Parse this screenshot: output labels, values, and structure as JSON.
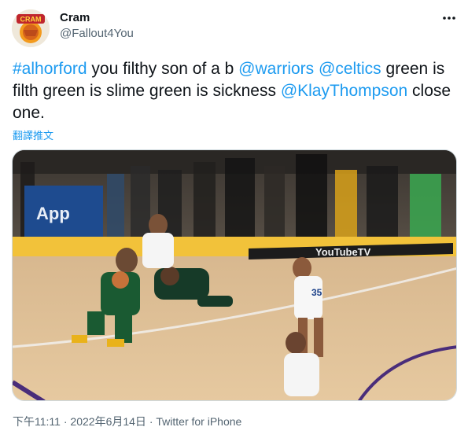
{
  "user": {
    "name": "Cram",
    "handle": "@Fallout4You",
    "avatar_text": "CRAM"
  },
  "tweet": {
    "parts": [
      {
        "text": "#alhorford",
        "type": "mention"
      },
      {
        "text": " you filthy son of a b ",
        "type": "text"
      },
      {
        "text": "@warriors",
        "type": "mention"
      },
      {
        "text": " ",
        "type": "text"
      },
      {
        "text": "@celtics",
        "type": "mention"
      },
      {
        "text": " green is filth green is slime green is sickness ",
        "type": "text"
      },
      {
        "text": "@KlayThompson",
        "type": "mention"
      },
      {
        "text": " close one.",
        "type": "text"
      }
    ],
    "translate_label": "翻譯推文"
  },
  "media": {
    "court_text_left": "App",
    "court_text_right": "YouTubeTV",
    "jersey_number": "35"
  },
  "meta": {
    "time": "下午11:11",
    "separator": " · ",
    "date": "2022年6月14日",
    "source": "Twitter for iPhone"
  },
  "colors": {
    "link": "#1d9bf0",
    "secondary_text": "#536471",
    "primary_text": "#0f1419"
  },
  "icons": {
    "more": "more-horizontal-icon"
  }
}
